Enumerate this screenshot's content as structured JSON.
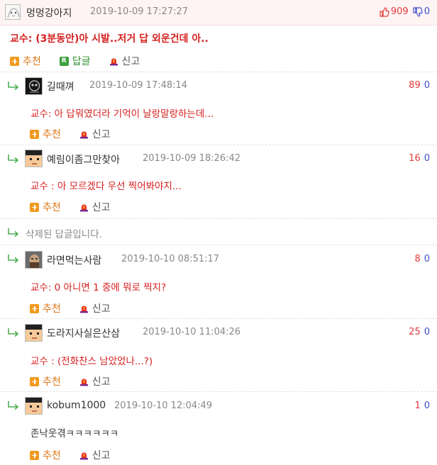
{
  "post": {
    "nickname": "멍멍강아지",
    "date": "2019-10-09 17:27:27",
    "upvotes": "909",
    "downvotes": "0",
    "text": "교수: (3분동안)아 시발..저거 답 외운건데 아..",
    "actions": {
      "recommend": "추천",
      "reply": "답글",
      "report": "신고"
    },
    "reply_icon_letter": "R"
  },
  "replies": [
    {
      "nickname": "길때껴",
      "date": "2019-10-09 17:48:14",
      "up": "89",
      "down": "0",
      "text": "교수: 아 답뭐였더라 기억이 날랑말랑하는데...",
      "recommend": "추천",
      "report": "신고"
    },
    {
      "nickname": "예림이좀그만찾아",
      "date": "2019-10-09 18:26:42",
      "up": "16",
      "down": "0",
      "text": "교수 : 아 모르겠다 우선 찍어봐야지...",
      "recommend": "추천",
      "report": "신고"
    },
    {
      "deleted_text": "삭제된 답글입니다."
    },
    {
      "nickname": "라면먹는사람",
      "date": "2019-10-10 08:51:17",
      "up": "8",
      "down": "0",
      "text": "교수: 0 아니면 1 중에 뭐로 찍지?",
      "recommend": "추천",
      "report": "신고"
    },
    {
      "nickname": "도라지사실은산삼",
      "date": "2019-10-10 11:04:26",
      "up": "25",
      "down": "0",
      "text": "교수 : (전화찬스 남았었나...?)",
      "recommend": "추천",
      "report": "신고"
    },
    {
      "nickname": "kobum1000",
      "date": "2019-10-10 12:04:49",
      "up": "1",
      "down": "0",
      "text": "존낙웃겪ㅋㅋㅋㅋㅋㅋ",
      "recommend": "추천",
      "report": "신고"
    }
  ],
  "colors": {
    "accent_red": "#d61f1f",
    "up_red": "#e03b3b",
    "down_blue": "#3b4ec8",
    "recommend_orange": "#f09a1e",
    "reply_green": "#3ea03e"
  }
}
